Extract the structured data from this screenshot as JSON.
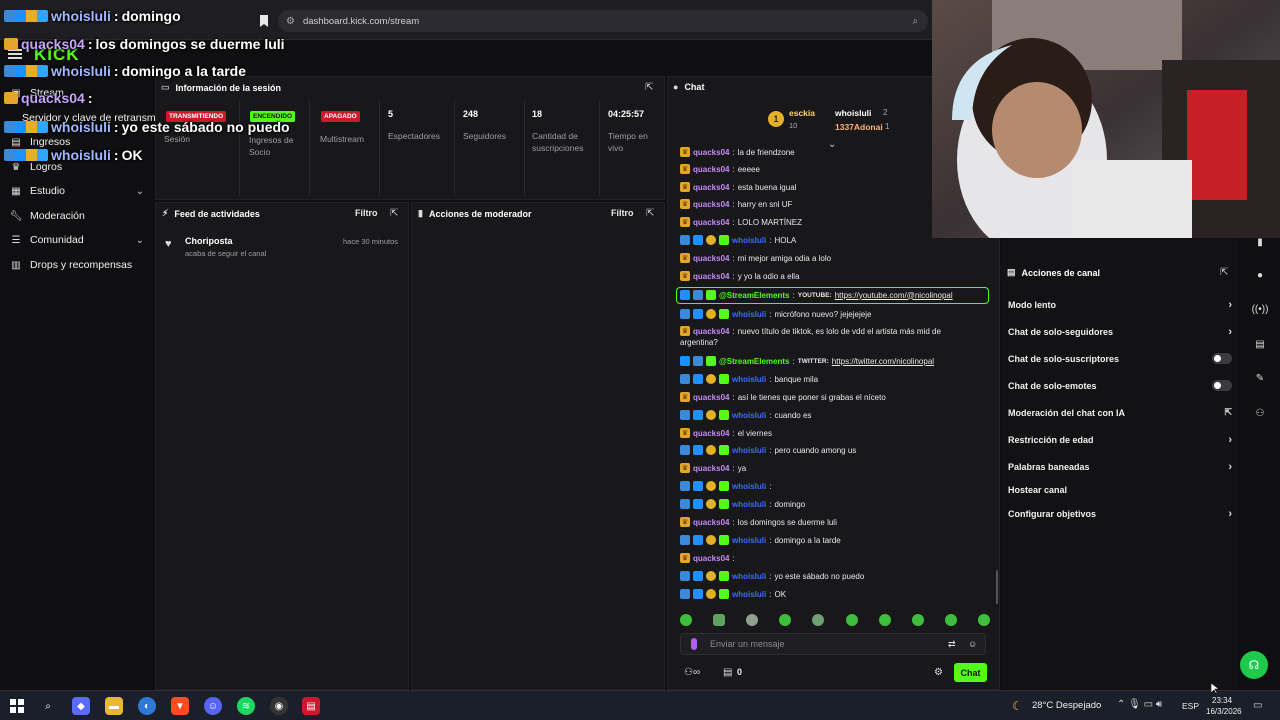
{
  "browser": {
    "url": "dashboard.kick.com/stream"
  },
  "brand": {
    "logo": "KICK",
    "accent": "#53fc18"
  },
  "sidebar": {
    "items": [
      {
        "label": "Stream"
      },
      {
        "label": "Servidor y clave de retransm"
      },
      {
        "label": "Ingresos"
      },
      {
        "label": "Logros"
      },
      {
        "label": "Estudio"
      },
      {
        "label": "Moderación"
      },
      {
        "label": "Comunidad"
      },
      {
        "label": "Drops y recompensas"
      }
    ]
  },
  "session": {
    "title": "Información de la sesión",
    "tags": {
      "live": "TRANSMITIENDO",
      "on": "ENCENDIDO",
      "off": "APAGADO"
    },
    "labels": {
      "session": "Sesión",
      "partner": "Ingresos de Socio",
      "multistream": "Multistream"
    },
    "stats": [
      {
        "value": "5",
        "label": "Espectadores"
      },
      {
        "value": "248",
        "label": "Seguidores"
      },
      {
        "value": "18",
        "label": "Cantidad de suscripciones"
      },
      {
        "value": "04:25:57",
        "label": "Tiempo en vivo"
      }
    ]
  },
  "activity": {
    "title": "Feed de actividades",
    "filter": "Filtro",
    "items": [
      {
        "name": "Choriposta",
        "desc": "acaba de seguir el canal",
        "time": "hace 30 minutos"
      }
    ]
  },
  "modactions": {
    "title": "Acciones de moderador",
    "filter": "Filtro"
  },
  "chat": {
    "title": "Chat",
    "leaderboard": [
      {
        "name": "esckia",
        "count": "10"
      },
      {
        "name": "whoisluli",
        "count": "2"
      },
      {
        "name": "1337Adonai",
        "count": "1"
      }
    ],
    "messages": [
      {
        "user": "quacks04",
        "text": "la de friendzone",
        "role": "viewer"
      },
      {
        "user": "quacks04",
        "text": "eeeee",
        "role": "viewer"
      },
      {
        "user": "quacks04",
        "text": "esta buena igual",
        "role": "viewer"
      },
      {
        "user": "quacks04",
        "text": "harry en snl UF",
        "role": "viewer"
      },
      {
        "user": "quacks04",
        "text": "LOLO MARTÍNEZ",
        "role": "viewer"
      },
      {
        "user": "whoisluli",
        "text": "HOLA",
        "role": "host"
      },
      {
        "user": "quacks04",
        "text": "mi mejor amiga odia a lolo",
        "role": "viewer"
      },
      {
        "user": "quacks04",
        "text": "y yo la odio a ella",
        "role": "viewer"
      },
      {
        "user": "@StreamElements",
        "text": "YOUTUBE:",
        "link": "https://youtube.com/@nicolinopal",
        "role": "bot"
      },
      {
        "user": "whoisluli",
        "text": "micrófono nuevo? jejejejeje",
        "role": "host"
      },
      {
        "user": "quacks04",
        "text": "nuevo título de tiktok, es lolo de vdd el artista más mid de",
        "role": "viewer"
      },
      {
        "user": "",
        "text": "argentina?",
        "role": "cont"
      },
      {
        "user": "@StreamElements",
        "text": "TWITTER:",
        "link": "https://twitter.com/nicolinopal",
        "role": "bot"
      },
      {
        "user": "whoisluli",
        "text": "banque mila",
        "role": "host"
      },
      {
        "user": "quacks04",
        "text": "así le tienes que poner si grabas el níceto",
        "role": "viewer"
      },
      {
        "user": "whoisluli",
        "text": "cuando es",
        "role": "host"
      },
      {
        "user": "quacks04",
        "text": "el viernes",
        "role": "viewer"
      },
      {
        "user": "whoisluli",
        "text": "pero cuando among us",
        "role": "host"
      },
      {
        "user": "quacks04",
        "text": "ya",
        "role": "viewer"
      },
      {
        "user": "whoisluli",
        "text": "",
        "role": "host"
      },
      {
        "user": "whoisluli",
        "text": "domingo",
        "role": "host"
      },
      {
        "user": "quacks04",
        "text": "los domingos se duerme luli",
        "role": "viewer"
      },
      {
        "user": "whoisluli",
        "text": "domingo a la tarde",
        "role": "host"
      },
      {
        "user": "quacks04",
        "text": "",
        "role": "viewer"
      },
      {
        "user": "whoisluli",
        "text": "yo este sábado no puedo",
        "role": "host"
      },
      {
        "user": "whoisluli",
        "text": "OK",
        "role": "host"
      }
    ],
    "placeholder": "Enviar un mensaje",
    "users_count": "0",
    "send_label": "Chat"
  },
  "overlay": {
    "lines": [
      {
        "user": "whoisluli",
        "text": "domingo"
      },
      {
        "user": "quacks04",
        "text": "los domingos se duerme luli"
      },
      {
        "user": "whoisluli",
        "text": "domingo a la tarde"
      },
      {
        "user": "quacks04",
        "text": ""
      },
      {
        "user": "whoisluli",
        "text": "yo este sábado no puedo"
      },
      {
        "user": "whoisluli",
        "text": "OK"
      }
    ]
  },
  "channel_actions": {
    "title": "Acciones de canal",
    "items": [
      {
        "label": "Modo lento",
        "kind": "chevron"
      },
      {
        "label": "Chat de solo-seguidores",
        "kind": "chevron"
      },
      {
        "label": "Chat de solo-suscriptores",
        "kind": "toggle"
      },
      {
        "label": "Chat de solo-emotes",
        "kind": "toggle"
      },
      {
        "label": "Moderación del chat con IA",
        "kind": "external"
      },
      {
        "label": "Restricción de edad",
        "kind": "chevron"
      },
      {
        "label": "Palabras baneadas",
        "kind": "chevron"
      },
      {
        "label": "Hostear canal",
        "kind": "none"
      },
      {
        "label": "Configurar objetivos",
        "kind": "chevron"
      }
    ]
  },
  "taskbar": {
    "weather": "28°C  Despejado",
    "lang": "ESP",
    "time": "23:34",
    "date": "16/3/2026"
  }
}
